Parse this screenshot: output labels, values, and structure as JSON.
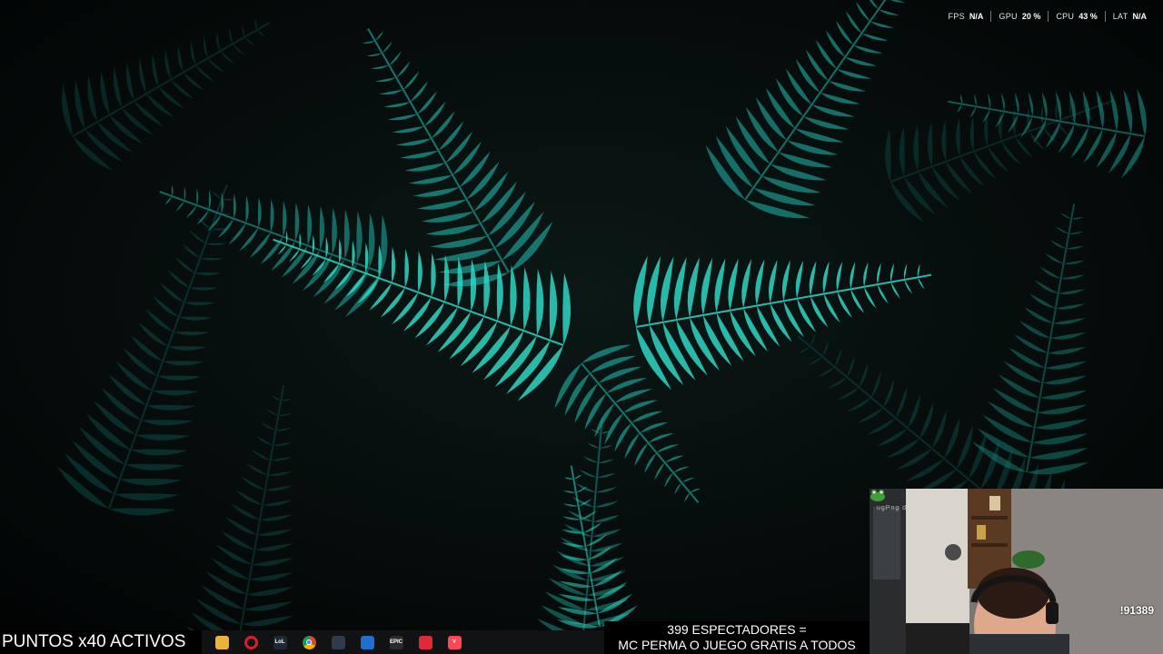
{
  "perf_overlay": {
    "items": [
      {
        "label": "FPS",
        "value": "N/A"
      },
      {
        "label": "GPU",
        "value": "20 %"
      },
      {
        "label": "CPU",
        "value": "43 %"
      },
      {
        "label": "LAT",
        "value": "N/A"
      }
    ]
  },
  "banners": {
    "points": "PUNTOS x40 ACTIVOS",
    "viewers_line1": "399 ESPECTADORES =",
    "viewers_line2": "MC PERMA O JUEGO GRATIS A TODOS"
  },
  "taskbar": {
    "icons": [
      {
        "name": "file-explorer-icon",
        "color": "#e8b43a",
        "glyph": ""
      },
      {
        "name": "opera-icon",
        "color": "#e01b2a",
        "glyph": "O"
      },
      {
        "name": "league-legends-icon",
        "color": "#1d2a33",
        "glyph": "LoL"
      },
      {
        "name": "chrome-icon",
        "color": "#3b9a4d",
        "glyph": ""
      },
      {
        "name": "windows-app-icon",
        "color": "#2f3a4a",
        "glyph": ""
      },
      {
        "name": "visual-studio-code-icon",
        "color": "#1f6fcf",
        "glyph": ""
      },
      {
        "name": "epic-games-icon",
        "color": "#2a2a2a",
        "glyph": "EPIC"
      },
      {
        "name": "streamlabs-icon",
        "color": "#e02a3a",
        "glyph": ""
      },
      {
        "name": "valorant-icon",
        "color": "#ff4655",
        "glyph": "V"
      }
    ]
  },
  "webcam": {
    "ticker": "ugPng draw an app",
    "counter": "!91389"
  },
  "colors": {
    "fern_bright": "#2fd6c4",
    "fern_mid": "#1a8f86",
    "fern_dark": "#0d4a47",
    "background": "#050807"
  }
}
